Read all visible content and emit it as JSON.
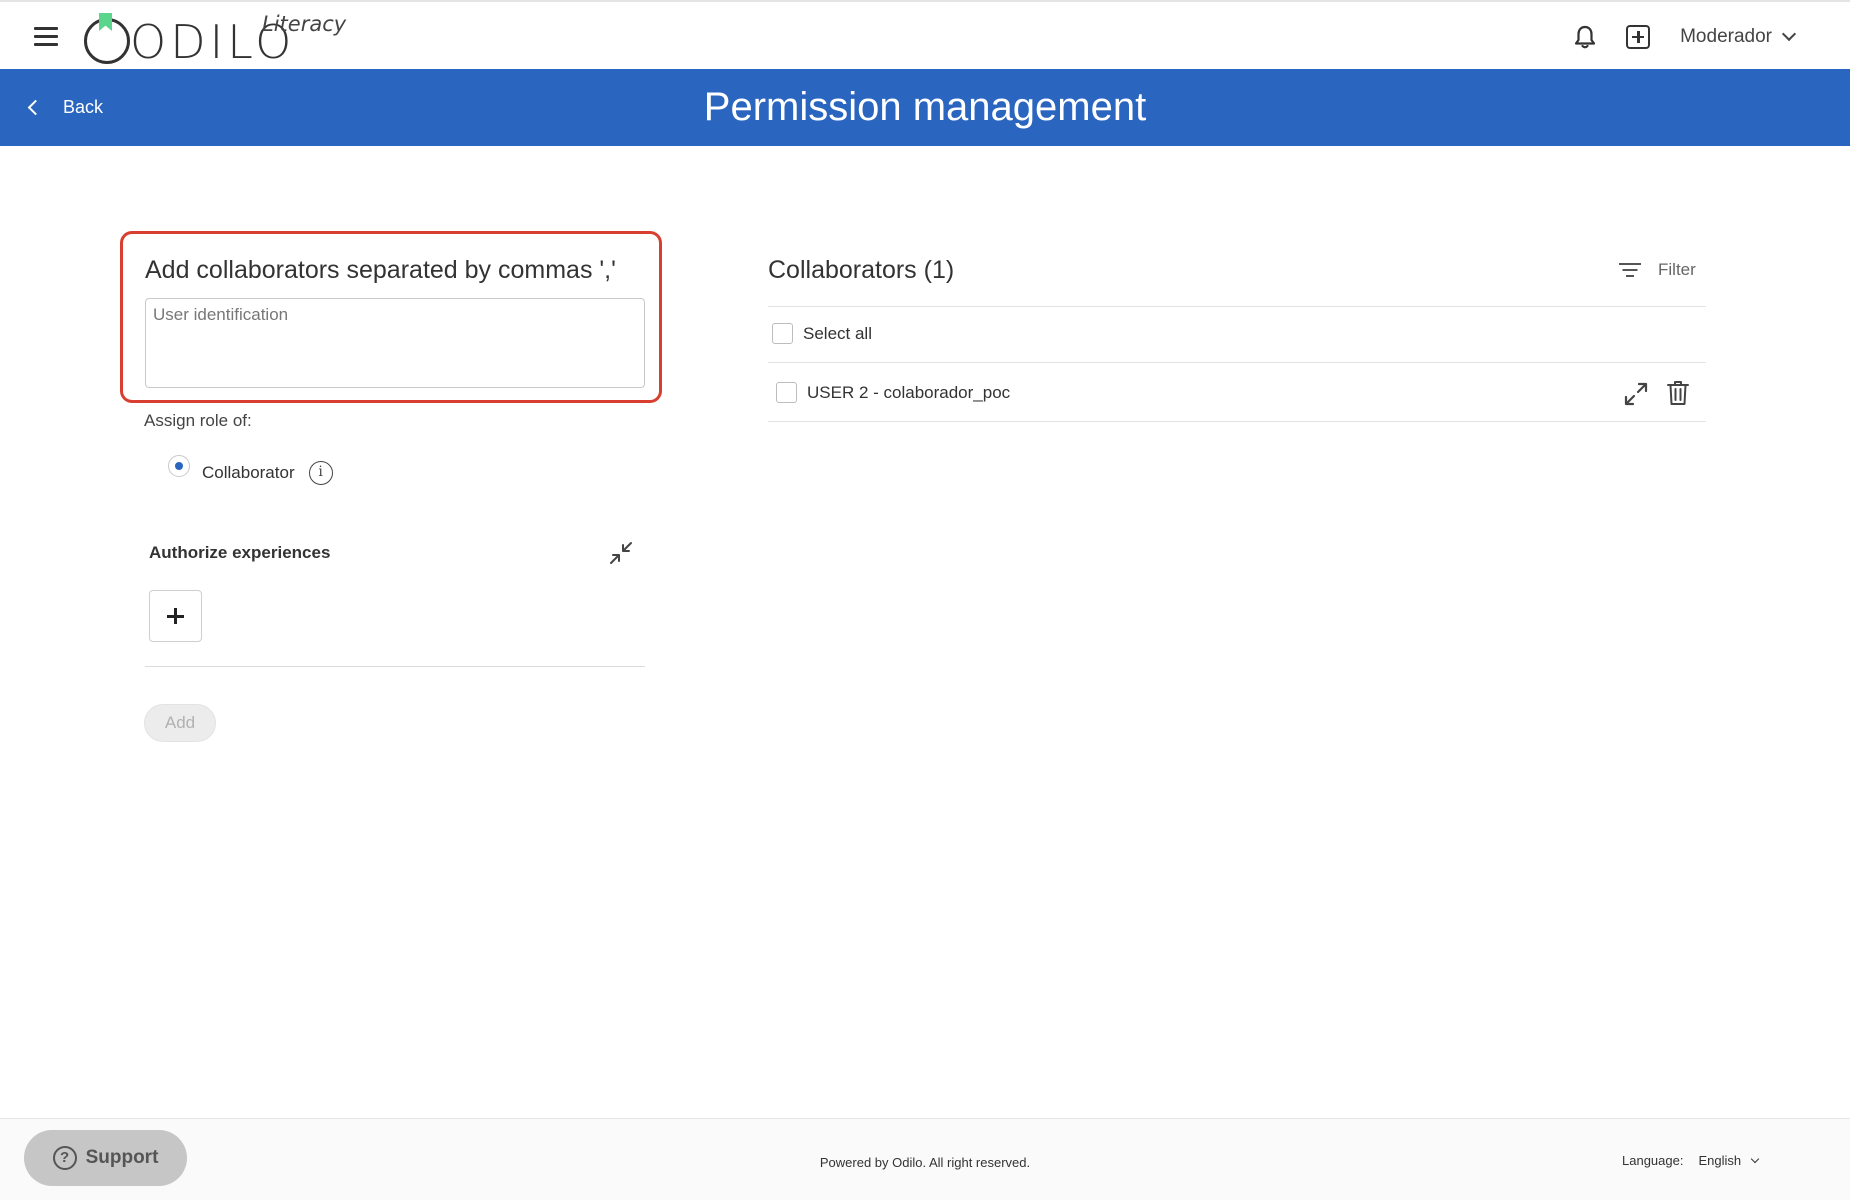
{
  "app": {
    "logo_text": "ODILO",
    "logo_subtitle": "Literacy",
    "brand_color": "#2a65bf"
  },
  "topbar": {
    "icons": [
      "menu-icon",
      "bell-icon",
      "add-square-icon",
      "chevron-down-icon"
    ],
    "user_menu_label": "Moderador"
  },
  "header": {
    "back_label": "Back",
    "title": "Permission management"
  },
  "add_collaborators": {
    "title": "Add collaborators separated by commas ','",
    "input_placeholder": "User identification",
    "input_value": "",
    "highlight_color": "#d93f30",
    "assign_role_label": "Assign role of:",
    "role_option": "Collaborator",
    "role_selected": true,
    "authorize_title": "Authorize experiences",
    "add_button_label": "Add"
  },
  "collaborators": {
    "title": "Collaborators (1)",
    "filter_label": "Filter",
    "select_all_label": "Select all",
    "items": [
      {
        "label": "USER 2 - colaborador_poc",
        "checked": false
      }
    ]
  },
  "footer": {
    "support_label": "Support",
    "powered_text": "Powered by Odilo. All right reserved.",
    "language_label": "Language:",
    "language_value": "English"
  }
}
